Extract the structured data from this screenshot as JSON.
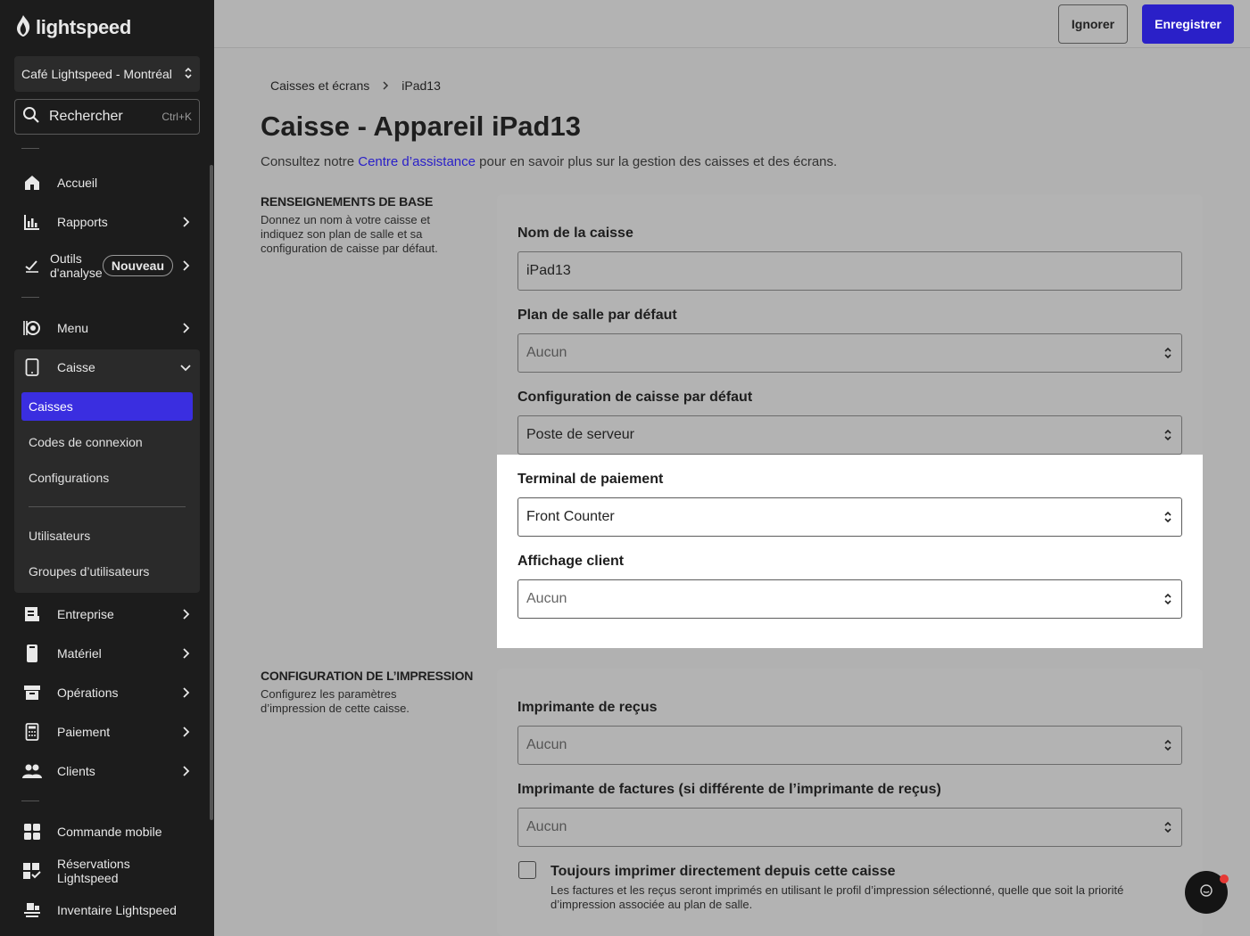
{
  "brand": {
    "name": "lightspeed"
  },
  "sidebar": {
    "location": "Café Lightspeed - Montréal",
    "search": {
      "label": "Rechercher",
      "shortcut": "Ctrl+K"
    },
    "items": {
      "accueil": "Accueil",
      "rapports": "Rapports",
      "outils_line1": "Outils",
      "outils_line2": "d'analyse",
      "outils_badge": "Nouveau",
      "menu": "Menu",
      "caisse": "Caisse",
      "entreprise": "Entreprise",
      "materiel": "Matériel",
      "operations": "Opérations",
      "paiement": "Paiement",
      "clients": "Clients",
      "commande_mobile": "Commande mobile",
      "reservations": "Réservations Lightspeed",
      "inventaire": "Inventaire Lightspeed"
    },
    "caisse_sub": {
      "caisses": "Caisses",
      "codes": "Codes de connexion",
      "configurations": "Configurations",
      "utilisateurs": "Utilisateurs",
      "groupes": "Groupes d’utilisateurs"
    }
  },
  "topbar": {
    "ignore_label": "Ignorer",
    "save_label": "Enregistrer"
  },
  "breadcrumb": {
    "parent": "Caisses et écrans",
    "current": "iPad13"
  },
  "page": {
    "title": "Caisse - Appareil iPad13",
    "subtitle_pre": "Consultez notre ",
    "subtitle_link": "Centre d’assistance",
    "subtitle_post": " pour en savoir plus sur la gestion des caisses et des écrans."
  },
  "basic": {
    "heading": "RENSEIGNEMENTS DE BASE",
    "description": "Donnez un nom à votre caisse et indiquez son plan de salle et sa configuration de caisse par défaut.",
    "name_label": "Nom de la caisse",
    "name_value": "iPad13",
    "floor_label": "Plan de salle par défaut",
    "floor_value": "Aucun",
    "config_label": "Configuration de caisse par défaut",
    "config_value": "Poste de serveur",
    "terminal_label": "Terminal de paiement",
    "terminal_value": "Front Counter",
    "display_label": "Affichage client",
    "display_value": "Aucun"
  },
  "print": {
    "heading": "CONFIGURATION DE L’IMPRESSION",
    "description": "Configurez les paramètres d’impression de cette caisse.",
    "receipt_label": "Imprimante de reçus",
    "receipt_value": "Aucun",
    "invoice_label": "Imprimante de factures (si différente de l’imprimante de reçus)",
    "invoice_value": "Aucun",
    "always_label": "Toujours imprimer directement depuis cette caisse",
    "always_desc": "Les factures et les reçus seront imprimés en utilisant le profil d’impression sélectionné, quelle que soit la priorité d’impression associée au plan de salle.",
    "always_checked": false
  },
  "colors": {
    "accent": "#2a20c8",
    "active_nav": "#3a2ee0",
    "sidebar_bg": "#1c1c1c",
    "notify": "#e53935"
  }
}
